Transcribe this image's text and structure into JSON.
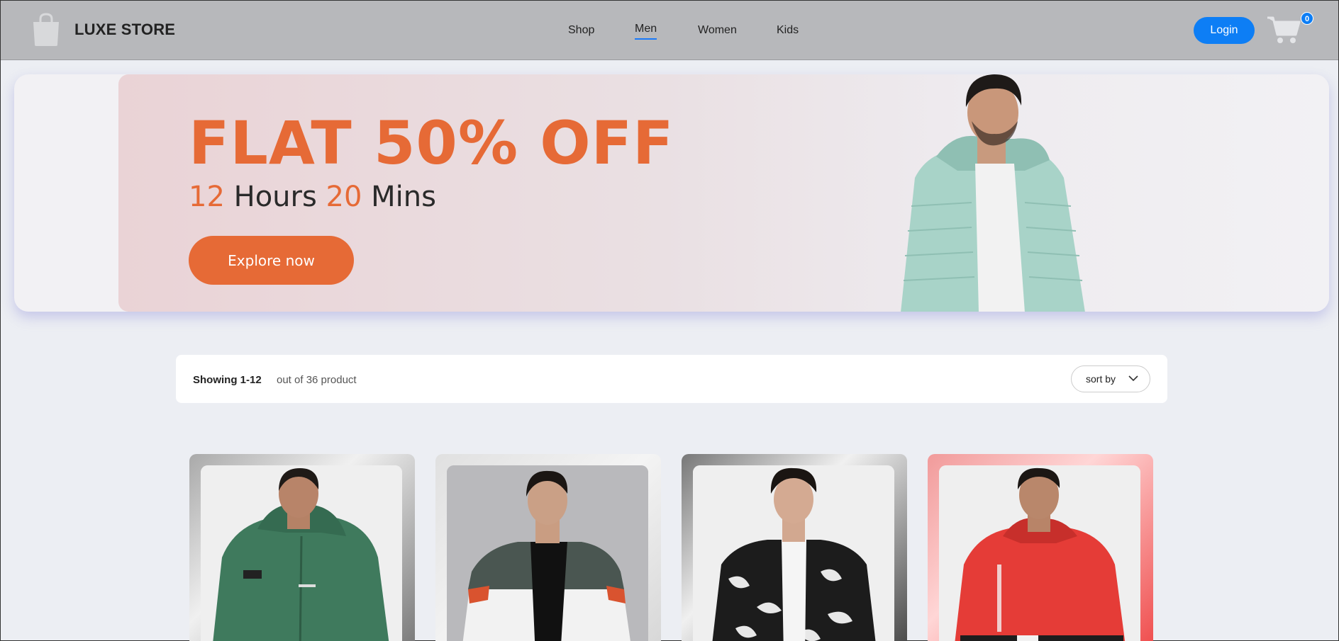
{
  "header": {
    "brand": "LUXE STORE",
    "nav": [
      "Shop",
      "Men",
      "Women",
      "Kids"
    ],
    "active_nav": "Men",
    "login_label": "Login",
    "cart_count": "0",
    "accent_color": "#0d7ef5"
  },
  "banner": {
    "title": "FLAT 50% OFF",
    "hours": "12",
    "hours_label": "Hours",
    "mins": "20",
    "mins_label": "Mins",
    "cta": "Explore now",
    "accent_color": "#e66a36"
  },
  "listing": {
    "showing": "Showing 1-12",
    "out_of": "out of 36 product",
    "sort_label": "sort by"
  },
  "products": [
    {
      "jacket": "green hooded zip jacket",
      "frame": "grey-gradient"
    },
    {
      "jacket": "white and dark grey puffer",
      "frame": "light-grey"
    },
    {
      "jacket": "black and white camo bomber",
      "frame": "dark-gradient"
    },
    {
      "jacket": "red urban windcheater",
      "frame": "red-gradient"
    }
  ]
}
